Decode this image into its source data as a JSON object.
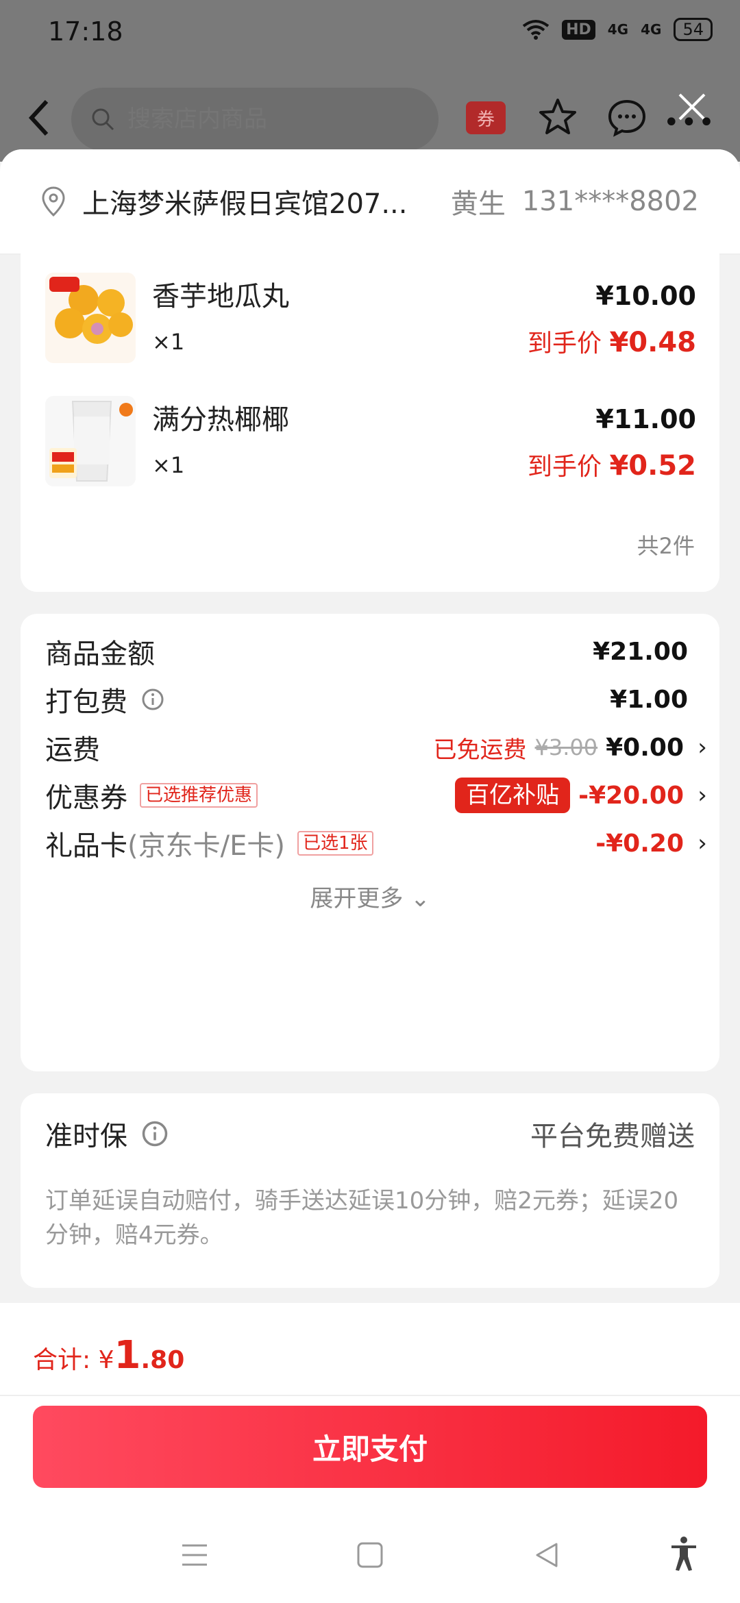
{
  "status_bar": {
    "time": "17:18",
    "network_badge": "HD",
    "net1": "4G",
    "net2": "4G",
    "battery": "54"
  },
  "nav": {
    "search_placeholder": "搜索店内商品",
    "coupon_icon_label": "券"
  },
  "address": {
    "text": "上海梦米萨假日宾馆207...",
    "name": "黄生",
    "phone": "131****8802"
  },
  "items": [
    {
      "name": "香芋地瓜丸",
      "qty": "×1",
      "price": "¥10.00",
      "final_label": "到手价",
      "final_price": "¥0.48"
    },
    {
      "name": "满分热椰椰",
      "qty": "×1",
      "price": "¥11.00",
      "final_label": "到手价",
      "final_price": "¥0.52"
    }
  ],
  "item_count": "共2件",
  "fees": {
    "goods_label": "商品金额",
    "goods_amount": "¥21.00",
    "packing_label": "打包费",
    "packing_amount": "¥1.00",
    "shipping_label": "运费",
    "shipping_free_text": "已免运费",
    "shipping_original": "¥3.00",
    "shipping_amount": "¥0.00",
    "coupon_label": "优惠券",
    "coupon_tag": "已选推荐优惠",
    "coupon_badge": "百亿补贴",
    "coupon_amount": "-¥20.00",
    "gift_label": "礼品卡",
    "gift_sub": "(京东卡/E卡)",
    "gift_tag": "已选1张",
    "gift_amount": "-¥0.20",
    "expand_text": "展开更多"
  },
  "ontime": {
    "title": "准时保",
    "right_text": "平台免费赠送",
    "desc": "订单延误自动赔付，骑手送达延误10分钟，赔2元券；延误20分钟，赔4元券。"
  },
  "footer": {
    "total_label": "合计:",
    "currency": "¥",
    "total_int": "1",
    "total_dec": ".80",
    "pay_button": "立即支付"
  },
  "colors": {
    "accent": "#e1251b",
    "pay_gradient_start": "#ff4a5f",
    "pay_gradient_end": "#f41a2a"
  }
}
